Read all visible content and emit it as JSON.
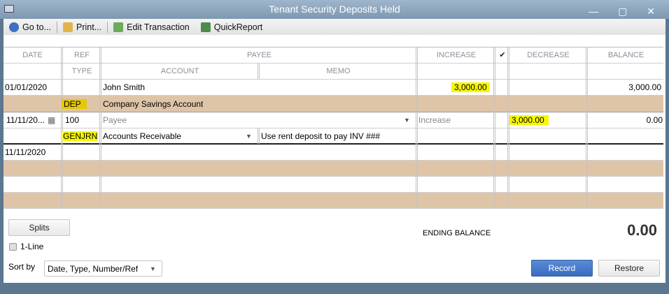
{
  "window": {
    "title": "Tenant Security Deposits Held",
    "controls": "— ▢ ✕"
  },
  "toolbar": {
    "goto": "Go to...",
    "print": "Print...",
    "edit": "Edit Transaction",
    "quickreport": "QuickReport"
  },
  "headers": {
    "date": "DATE",
    "ref": "REF",
    "payee": "PAYEE",
    "increase": "INCREASE",
    "check": "✔",
    "decrease": "DECREASE",
    "balance": "BALANCE",
    "type": "TYPE",
    "account": "ACCOUNT",
    "memo": "MEMO"
  },
  "rows": [
    {
      "date": "01/01/2020",
      "ref": "",
      "payee": "John Smith",
      "increase": "3,000.00",
      "decrease": "",
      "balance": "3,000.00",
      "type": "DEP",
      "account": "Company Savings Account",
      "memo": ""
    },
    {
      "date": "11/11/20...",
      "ref": "100",
      "payee_placeholder": "Payee",
      "increase_placeholder": "Increase",
      "decrease": "3,000.00",
      "balance": "0.00",
      "type": "GENJRN",
      "account": "Accounts Receivable",
      "memo": "Use rent deposit to pay INV ###"
    },
    {
      "date": "11/11/2020"
    }
  ],
  "footer": {
    "splits": "Splits",
    "one_line": "1-Line",
    "sort_by_label": "Sort by",
    "sort_by_value": "Date, Type, Number/Ref",
    "ending_balance_label": "ENDING BALANCE",
    "ending_balance": "0.00",
    "record": "Record",
    "restore": "Restore"
  }
}
